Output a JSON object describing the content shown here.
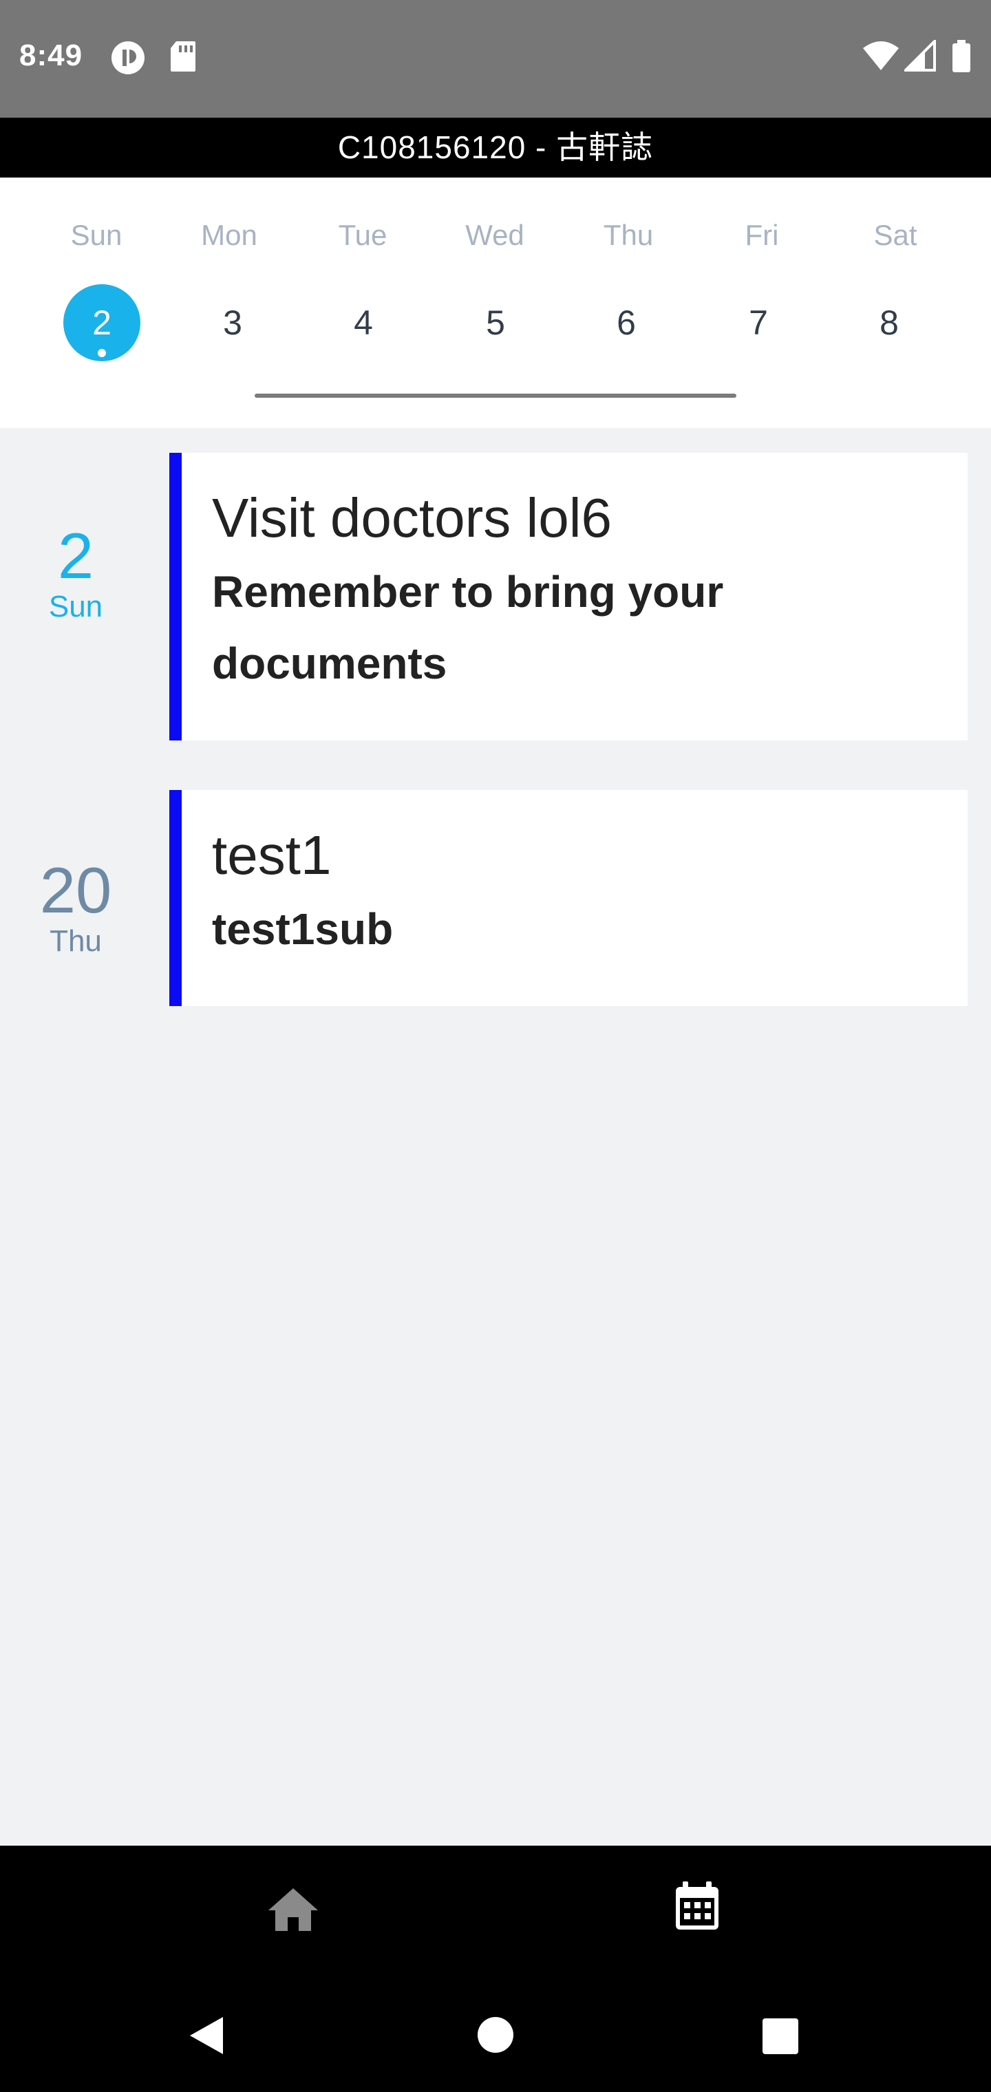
{
  "status_bar": {
    "time": "8:49",
    "icons": [
      "app-notification-icon",
      "sd-card-icon",
      "wifi-icon",
      "cell-signal-icon",
      "battery-icon"
    ]
  },
  "header": {
    "title": "C108156120 - 古軒誌"
  },
  "week": {
    "days": [
      {
        "dow": "Sun",
        "num": "2",
        "selected": true
      },
      {
        "dow": "Mon",
        "num": "3"
      },
      {
        "dow": "Tue",
        "num": "4"
      },
      {
        "dow": "Wed",
        "num": "5"
      },
      {
        "dow": "Thu",
        "num": "6"
      },
      {
        "dow": "Fri",
        "num": "7"
      },
      {
        "dow": "Sat",
        "num": "8"
      }
    ]
  },
  "events": [
    {
      "day_num": "2",
      "day_name": "Sun",
      "title": "Visit doctors lol6",
      "subtitle": "Remember to bring your documents"
    },
    {
      "day_num": "20",
      "day_name": "Thu",
      "title": "test1",
      "subtitle": "test1sub"
    }
  ],
  "bottom_nav": {
    "items": [
      "home-icon",
      "calendar-icon"
    ],
    "active": "calendar-icon"
  },
  "system_nav": [
    "back-icon",
    "home-circle-icon",
    "recents-icon"
  ],
  "colors": {
    "accent": "#1ab2ea",
    "event_bar": "#0a0af5",
    "date_muted": "#6e8aa5"
  }
}
